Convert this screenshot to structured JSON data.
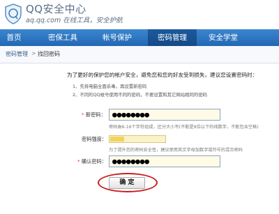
{
  "header": {
    "title": "QQ安全中心",
    "subtitle": "aq.qq.com 在线工具，安全护航",
    "logo_icon": "qq-shield-icon"
  },
  "nav": {
    "items": [
      {
        "label": "首页",
        "active": false
      },
      {
        "label": "密保工具",
        "active": false
      },
      {
        "label": "帐号保护",
        "active": false
      },
      {
        "label": "密码管理",
        "active": true
      },
      {
        "label": "安全学堂",
        "active": false
      }
    ]
  },
  "breadcrumb": {
    "parent": "密码管理",
    "separator": ">",
    "current": "找回密码"
  },
  "form": {
    "intro": "为了更好的保护您的帐户安全，避免您和您的好友受到损失，建议您设置密码时：",
    "tips": [
      "1、先将电脑全面杀毒，再设置新密码",
      "2、不同的QQ帐号使用不同的密码，不要设置和其它网站相同的密码"
    ],
    "new_password": {
      "label": "新密码：",
      "required_mark": "*",
      "value": "●●●●●●●●",
      "hint": "密码由6-16个字符组成，区分大小写(不能是9位以下的纯数字，不能包含空格)"
    },
    "strength": {
      "label": "密码强度：",
      "level": 0.25,
      "hint": "为了提升您的密码安全性，建议使用英文字母加数字或符号的混合密码"
    },
    "confirm_password": {
      "label": "确认密码：",
      "required_mark": "*",
      "value": "●●●●●●●●"
    },
    "submit_label": "确  定"
  },
  "colors": {
    "nav_bg": "#2b74c0",
    "nav_active": "#174f8f",
    "highlight_ring": "#cc1c1c"
  }
}
